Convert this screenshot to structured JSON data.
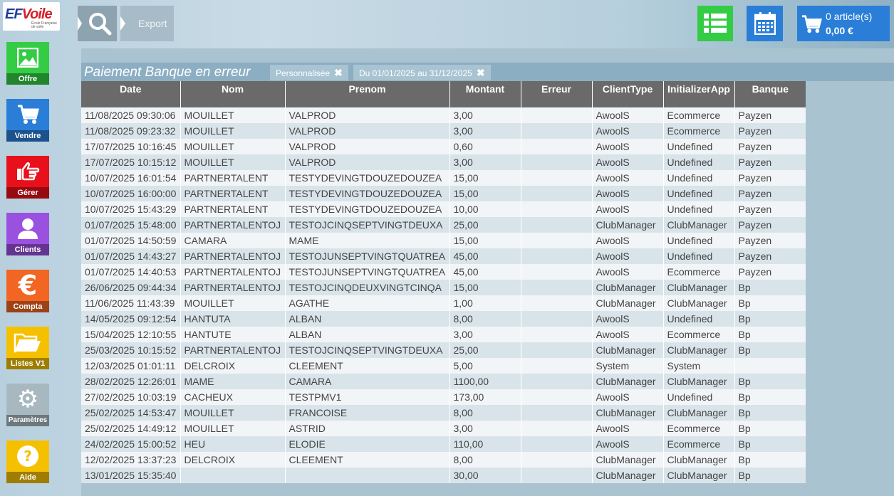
{
  "logo": {
    "text_main": "EF",
    "text_accent": "Voile",
    "subtitle": "École Française de voile"
  },
  "sidebar": {
    "items": [
      {
        "label": "Offre",
        "icon": "image-icon",
        "color": "#33cc44"
      },
      {
        "label": "Vendre",
        "icon": "cart-icon",
        "color": "#2a7ed8"
      },
      {
        "label": "Gérer",
        "icon": "hand-pointer-icon",
        "color": "#e8101a"
      },
      {
        "label": "Clients",
        "icon": "user-icon",
        "color": "#9b51e0"
      },
      {
        "label": "Compta",
        "icon": "euro-icon",
        "color": "#f26522"
      },
      {
        "label": "Listes V1",
        "icon": "folder-icon",
        "color": "#f5c000"
      },
      {
        "label": "Paramètres",
        "icon": "gear-icon",
        "color": "#a8b8c0"
      },
      {
        "label": "Aide",
        "icon": "help-icon",
        "color": "#f5c000"
      }
    ]
  },
  "toolbar": {
    "export_label": "Export",
    "cart_count": "0 article(s)",
    "cart_amount": "0,00 €"
  },
  "page": {
    "title": "Paiement Banque en erreur",
    "filters": [
      {
        "label": "Personnalisée"
      },
      {
        "label": "Du 01/01/2025 au 31/12/2025"
      }
    ]
  },
  "table": {
    "columns": [
      "Date",
      "Nom",
      "Prenom",
      "Montant",
      "Erreur",
      "ClientType",
      "InitializerApp",
      "Banque"
    ],
    "rows": [
      [
        "11/08/2025 09:30:06",
        "MOUILLET",
        "VALPROD",
        "3,00",
        "",
        "AwoolS",
        "Ecommerce",
        "Payzen"
      ],
      [
        "11/08/2025 09:23:32",
        "MOUILLET",
        "VALPROD",
        "3,00",
        "",
        "AwoolS",
        "Ecommerce",
        "Payzen"
      ],
      [
        "17/07/2025 10:16:45",
        "MOUILLET",
        "VALPROD",
        "0,60",
        "",
        "AwoolS",
        "Undefined",
        "Payzen"
      ],
      [
        "17/07/2025 10:15:12",
        "MOUILLET",
        "VALPROD",
        "3,00",
        "",
        "AwoolS",
        "Undefined",
        "Payzen"
      ],
      [
        "10/07/2025 16:01:54",
        "PARTNERTALENT",
        "TESTYDEVINGTDOUZEDOUZEA",
        "15,00",
        "",
        "AwoolS",
        "Undefined",
        "Payzen"
      ],
      [
        "10/07/2025 16:00:00",
        "PARTNERTALENT",
        "TESTYDEVINGTDOUZEDOUZEA",
        "15,00",
        "",
        "AwoolS",
        "Undefined",
        "Payzen"
      ],
      [
        "10/07/2025 15:43:29",
        "PARTNERTALENT",
        "TESTYDEVINGTDOUZEDOUZEA",
        "10,00",
        "",
        "AwoolS",
        "Undefined",
        "Payzen"
      ],
      [
        "01/07/2025 15:48:00",
        "PARTNERTALENTOJ",
        "TESTOJCINQSEPTVINGTDEUXA",
        "25,00",
        "",
        "ClubManager",
        "ClubManager",
        "Payzen"
      ],
      [
        "01/07/2025 14:50:59",
        "CAMARA",
        "MAME",
        "15,00",
        "",
        "AwoolS",
        "Undefined",
        "Payzen"
      ],
      [
        "01/07/2025 14:43:27",
        "PARTNERTALENTOJ",
        "TESTOJUNSEPTVINGTQUATREA",
        "45,00",
        "",
        "AwoolS",
        "Undefined",
        "Payzen"
      ],
      [
        "01/07/2025 14:40:53",
        "PARTNERTALENTOJ",
        "TESTOJUNSEPTVINGTQUATREA",
        "45,00",
        "",
        "AwoolS",
        "Ecommerce",
        "Payzen"
      ],
      [
        "26/06/2025 09:44:34",
        "PARTNERTALENTOJ",
        "TESTOJCINQDEUXVINGTCINQA",
        "15,00",
        "",
        "ClubManager",
        "ClubManager",
        "Bp"
      ],
      [
        "11/06/2025 11:43:39",
        "MOUILLET",
        "AGATHE",
        "1,00",
        "",
        "ClubManager",
        "ClubManager",
        "Bp"
      ],
      [
        "14/05/2025 09:12:54",
        "HANTUTA",
        "ALBAN",
        "8,00",
        "",
        "AwoolS",
        "Undefined",
        "Bp"
      ],
      [
        "15/04/2025 12:10:55",
        "HANTUTE",
        "ALBAN",
        "3,00",
        "",
        "AwoolS",
        "Ecommerce",
        "Bp"
      ],
      [
        "25/03/2025 10:15:52",
        "PARTNERTALENTOJ",
        "TESTOJCINQSEPTVINGTDEUXA",
        "25,00",
        "",
        "ClubManager",
        "ClubManager",
        "Bp"
      ],
      [
        "12/03/2025 01:01:11",
        "DELCROIX",
        "CLEEMENT",
        "5,00",
        "",
        "System",
        "System",
        ""
      ],
      [
        "28/02/2025 12:26:01",
        "MAME",
        "CAMARA",
        "1100,00",
        "",
        "ClubManager",
        "ClubManager",
        "Bp"
      ],
      [
        "27/02/2025 10:03:19",
        "CACHEUX",
        "TESTPMV1",
        "173,00",
        "",
        "AwoolS",
        "Undefined",
        "Bp"
      ],
      [
        "25/02/2025 14:53:47",
        "MOUILLET",
        "FRANCOISE",
        "8,00",
        "",
        "ClubManager",
        "ClubManager",
        "Bp"
      ],
      [
        "25/02/2025 14:49:12",
        "MOUILLET",
        "ASTRID",
        "3,00",
        "",
        "AwoolS",
        "Ecommerce",
        "Bp"
      ],
      [
        "24/02/2025 15:00:52",
        "HEU",
        "ELODIE",
        "110,00",
        "",
        "AwoolS",
        "Ecommerce",
        "Bp"
      ],
      [
        "12/02/2025 13:37:23",
        "DELCROIX",
        "CLEEMENT",
        "8,00",
        "",
        "ClubManager",
        "ClubManager",
        "Bp"
      ],
      [
        "13/01/2025 15:35:40",
        "",
        "",
        "30,00",
        "",
        "ClubManager",
        "ClubManager",
        "Bp"
      ]
    ]
  }
}
